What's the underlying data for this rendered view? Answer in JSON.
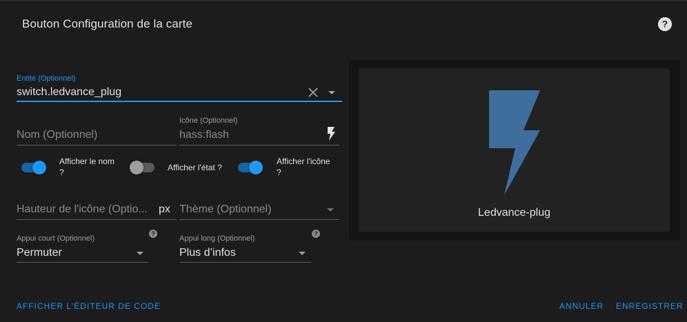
{
  "dialog": {
    "title": "Bouton Configuration de la carte"
  },
  "entity": {
    "label": "Entité (Optionnel)",
    "value": "switch.ledvance_plug"
  },
  "name_field": {
    "placeholder": "Nom (Optionnel)"
  },
  "icon_field": {
    "label": "Icône (Optionnel)",
    "value": "hass:flash"
  },
  "toggles": {
    "show_name": {
      "label_line1": "Afficher le nom",
      "label_line2": "?",
      "state": "on"
    },
    "show_state": {
      "label": "Afficher l'état ?",
      "state": "off"
    },
    "show_icon": {
      "label_line1": "Afficher l'icône",
      "label_line2": "?",
      "state": "on"
    }
  },
  "icon_height": {
    "placeholder": "Hauteur de l'icône (Optio...",
    "suffix": "px"
  },
  "theme": {
    "placeholder": "Thème (Optionnel)"
  },
  "tap_action": {
    "label": "Appui court (Optionnel)",
    "value": "Permuter"
  },
  "hold_action": {
    "label": "Appui long (Optionnel)",
    "value": "Plus d’infos"
  },
  "preview": {
    "name": "Ledvance-plug",
    "icon": "flash-icon",
    "icon_color": "#3f6e9e"
  },
  "actions": {
    "code_editor": "AFFICHER L'ÉDITEUR DE CODE",
    "cancel": "ANNULER",
    "save": "ENREGISTRER"
  },
  "colors": {
    "accent": "#2196f3",
    "background": "#1c1c1c"
  }
}
